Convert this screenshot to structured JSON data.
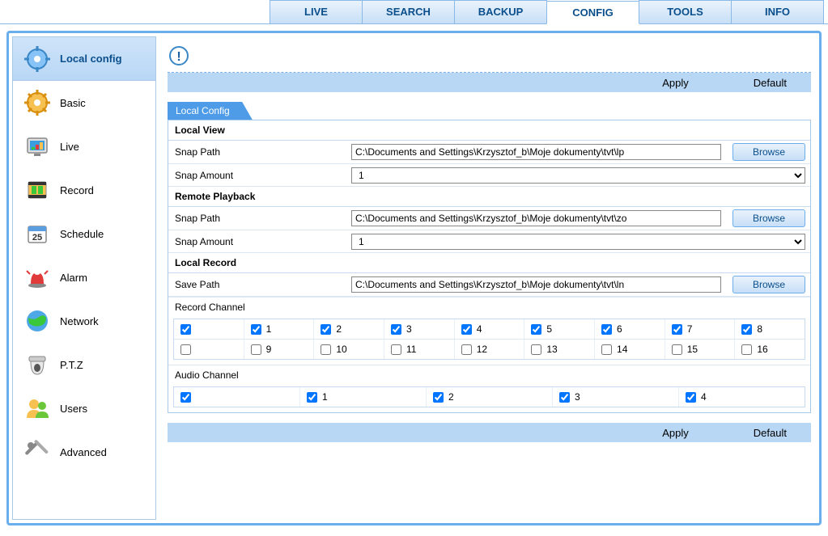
{
  "topnav": {
    "tabs": [
      "LIVE",
      "SEARCH",
      "BACKUP",
      "CONFIG",
      "TOOLS",
      "INFO"
    ],
    "active": "CONFIG"
  },
  "sidebar": {
    "items": [
      {
        "label": "Local config",
        "icon": "gear-blue-icon",
        "active": true
      },
      {
        "label": "Basic",
        "icon": "gear-orange-icon",
        "active": false
      },
      {
        "label": "Live",
        "icon": "monitor-icon",
        "active": false
      },
      {
        "label": "Record",
        "icon": "film-icon",
        "active": false
      },
      {
        "label": "Schedule",
        "icon": "calendar-icon",
        "active": false
      },
      {
        "label": "Alarm",
        "icon": "alarm-icon",
        "active": false
      },
      {
        "label": "Network",
        "icon": "globe-icon",
        "active": false
      },
      {
        "label": "P.T.Z",
        "icon": "camera-dome-icon",
        "active": false
      },
      {
        "label": "Users",
        "icon": "users-icon",
        "active": false
      },
      {
        "label": "Advanced",
        "icon": "tools-icon",
        "active": false
      }
    ]
  },
  "actions": {
    "apply": "Apply",
    "default": "Default"
  },
  "section": {
    "title": "Local Config",
    "local_view": {
      "header": "Local View",
      "snap_path_label": "Snap Path",
      "snap_path_value": "C:\\Documents and Settings\\Krzysztof_b\\Moje dokumenty\\tvt\\lp",
      "snap_amount_label": "Snap Amount",
      "snap_amount_value": "1",
      "browse": "Browse"
    },
    "remote_playback": {
      "header": "Remote Playback",
      "snap_path_label": "Snap Path",
      "snap_path_value": "C:\\Documents and Settings\\Krzysztof_b\\Moje dokumenty\\tvt\\zo",
      "snap_amount_label": "Snap Amount",
      "snap_amount_value": "1",
      "browse": "Browse"
    },
    "local_record": {
      "header": "Local Record",
      "save_path_label": "Save Path",
      "save_path_value": "C:\\Documents and Settings\\Krzysztof_b\\Moje dokumenty\\tvt\\ln",
      "browse": "Browse",
      "record_channel_label": "Record Channel",
      "record_channels_row1": [
        {
          "label": "",
          "checked": true
        },
        {
          "label": "1",
          "checked": true
        },
        {
          "label": "2",
          "checked": true
        },
        {
          "label": "3",
          "checked": true
        },
        {
          "label": "4",
          "checked": true
        },
        {
          "label": "5",
          "checked": true
        },
        {
          "label": "6",
          "checked": true
        },
        {
          "label": "7",
          "checked": true
        },
        {
          "label": "8",
          "checked": true
        }
      ],
      "record_channels_row2": [
        {
          "label": "",
          "checked": false
        },
        {
          "label": "9",
          "checked": false
        },
        {
          "label": "10",
          "checked": false
        },
        {
          "label": "11",
          "checked": false
        },
        {
          "label": "12",
          "checked": false
        },
        {
          "label": "13",
          "checked": false
        },
        {
          "label": "14",
          "checked": false
        },
        {
          "label": "15",
          "checked": false
        },
        {
          "label": "16",
          "checked": false
        }
      ],
      "audio_channel_label": "Audio Channel",
      "audio_channels": [
        {
          "label": "",
          "checked": true
        },
        {
          "label": "1",
          "checked": true
        },
        {
          "label": "2",
          "checked": true
        },
        {
          "label": "3",
          "checked": true
        },
        {
          "label": "4",
          "checked": true
        }
      ]
    }
  }
}
